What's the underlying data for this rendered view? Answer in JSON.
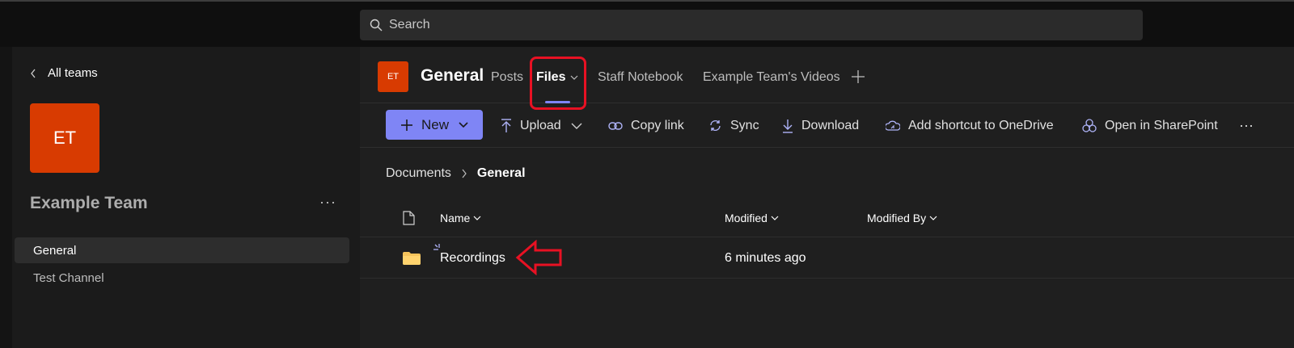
{
  "search": {
    "placeholder": "Search"
  },
  "sidebar": {
    "back_label": "All teams",
    "team_initials": "ET",
    "team_name": "Example Team",
    "more": "···",
    "channels": [
      {
        "label": "General",
        "active": true
      },
      {
        "label": "Test Channel",
        "active": false
      }
    ]
  },
  "header": {
    "initials": "ET",
    "channel_name": "General",
    "tabs": [
      {
        "label": "Posts"
      },
      {
        "label": "Files",
        "active": true
      },
      {
        "label": "Staff Notebook"
      },
      {
        "label": "Example Team's Videos"
      }
    ]
  },
  "toolbar": {
    "new": "New",
    "upload": "Upload",
    "copy_link": "Copy link",
    "sync": "Sync",
    "download": "Download",
    "add_shortcut": "Add shortcut to OneDrive",
    "open_sharepoint": "Open in SharePoint",
    "more": "···"
  },
  "breadcrumb": {
    "root": "Documents",
    "current": "General"
  },
  "table": {
    "columns": [
      "Name",
      "Modified",
      "Modified By"
    ],
    "rows": [
      {
        "name": "Recordings",
        "modified": "6 minutes ago",
        "modified_by": "",
        "type": "folder"
      }
    ]
  },
  "colors": {
    "accent": "#7f85f5",
    "team": "#d83b01",
    "highlight": "#e81123",
    "folder": "#f5c35b"
  },
  "icons": [
    "search-icon",
    "chevron-left-icon",
    "add-icon",
    "upload-icon",
    "link-icon",
    "sync-icon",
    "download-icon",
    "onedrive-shortcut-icon",
    "sharepoint-icon",
    "file-icon",
    "folder-icon",
    "new-item-sparkle-icon",
    "chevron-down-icon",
    "chevron-right-icon",
    "arrow-annotation-icon"
  ]
}
